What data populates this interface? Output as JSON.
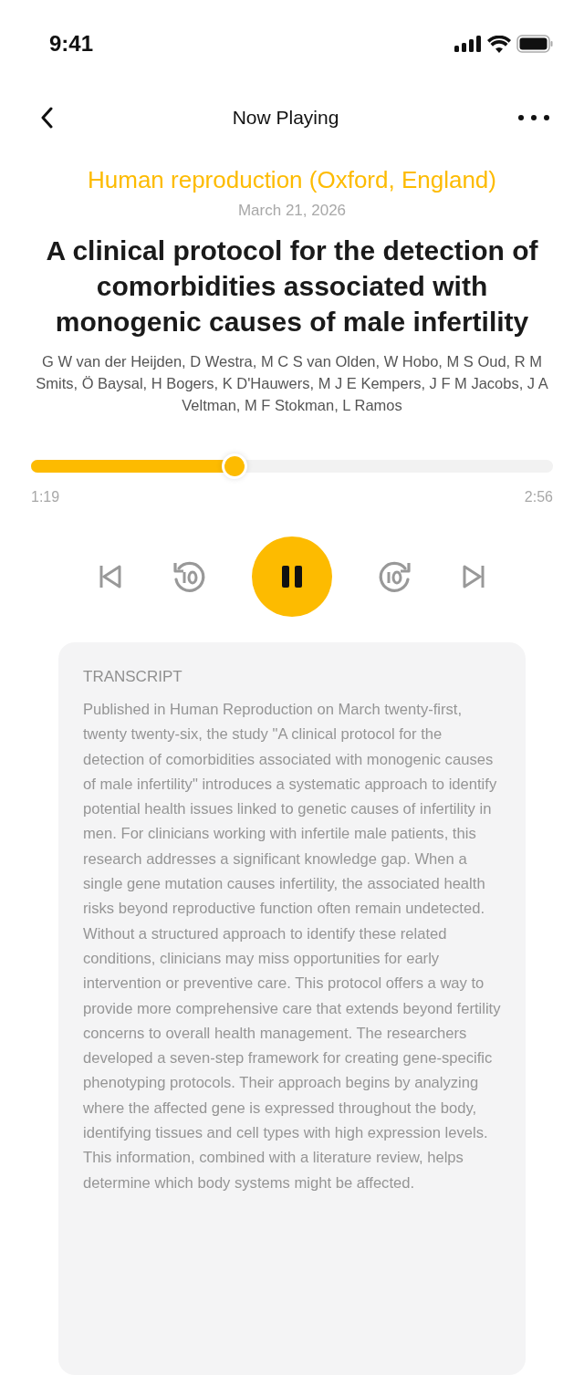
{
  "status_bar": {
    "time": "9:41"
  },
  "nav": {
    "title": "Now Playing"
  },
  "article": {
    "journal": "Human reproduction (Oxford, England)",
    "date": "March 21, 2026",
    "title": "A clinical protocol for the detection of comorbidities associated with monogenic causes of male infertility",
    "authors": "G W van der Heijden, D Westra, M C S van Olden, W Hobo, M S Oud, R M Smits, Ö Baysal, H Bogers, K D'Hauwers, M J E Kempers, J F M Jacobs, J A Veltman, M F Stokman, L Ramos"
  },
  "player": {
    "level": 0.39,
    "elapsed": "1:19",
    "duration": "2:56",
    "playing": true
  },
  "transcript": {
    "heading": "TRANSCRIPT",
    "text": "Published in Human Reproduction on March twenty-first, twenty twenty-six, the study \"A clinical protocol for the detection of comorbidities associated with monogenic causes of male infertility\" introduces a systematic approach to identify potential health issues linked to genetic causes of infertility in men. For clinicians working with infertile male patients, this research addresses a significant knowledge gap. When a single gene mutation causes infertility, the associated health risks beyond reproductive function often remain undetected. Without a structured approach to identify these related conditions, clinicians may miss opportunities for early intervention or preventive care. This protocol offers a way to provide more comprehensive care that extends beyond fertility concerns to overall health management. The researchers developed a seven-step framework for creating gene-specific phenotyping protocols. Their approach begins by analyzing where the affected gene is expressed throughout the body, identifying tissues and cell types with high expression levels. This information, combined with a literature review, helps determine which body systems might be affected."
  }
}
